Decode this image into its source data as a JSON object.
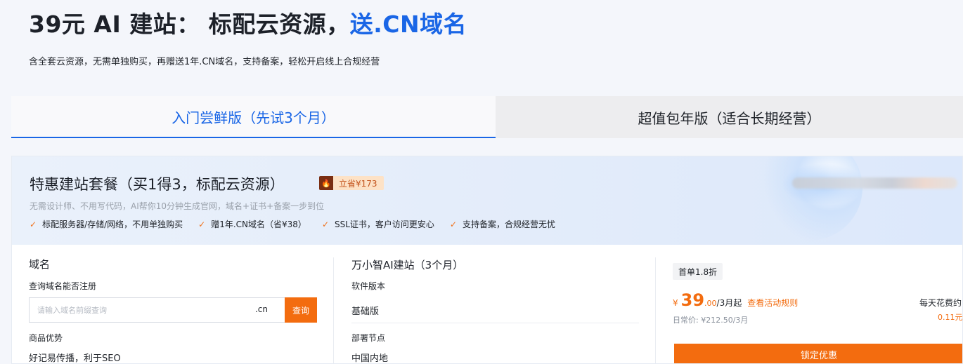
{
  "hero": {
    "title_main": "39元 AI 建站： 标配云资源，",
    "title_highlight": "送.CN域名",
    "subtitle": "含全套云资源，无需单独购买，再赠送1年.CN域名，支持备案，轻松开启线上合规经营"
  },
  "tabs": [
    {
      "label": "入门尝鲜版（先试3个月）",
      "active": true
    },
    {
      "label": "超值包年版（适合长期经营）",
      "active": false
    }
  ],
  "package": {
    "title": "特惠建站套餐（买1得3，标配云资源）",
    "save_badge": "立省¥173",
    "description": "无需设计师、不用写代码，AI帮你10分钟生成官网，域名+证书+备案一步到位",
    "features": [
      "标配服务器/存储/网络，不用单独购买",
      "赠1年.CN域名（省¥38）",
      "SSL证书，客户访问更安心",
      "支持备案，合规经营无忧"
    ]
  },
  "domain": {
    "heading": "域名",
    "query_label": "查询域名能否注册",
    "placeholder": "请输入域名前缀查询",
    "suffix": ".cn",
    "query_button": "查询",
    "advantage_label": "商品优势",
    "advantage_value": "好记易传播，利于SEO"
  },
  "product": {
    "heading": "万小智AI建站（3个月）",
    "version_label": "软件版本",
    "version_value": "基础版",
    "node_label": "部署节点",
    "node_value": "中国内地"
  },
  "pricing": {
    "first_order_badge": "首单1.8折",
    "currency": "¥",
    "price_int": "39",
    "price_dec": ".00",
    "price_unit": "/3月起",
    "rules_link": "查看活动规则",
    "regular_price": "日常价: ¥212.50/3月",
    "daily_label": "每天花费约",
    "daily_value": "0.11元",
    "lock_button": "锁定优惠"
  },
  "colors": {
    "brand_blue": "#1a66e6",
    "accent_orange": "#f36c0f"
  }
}
